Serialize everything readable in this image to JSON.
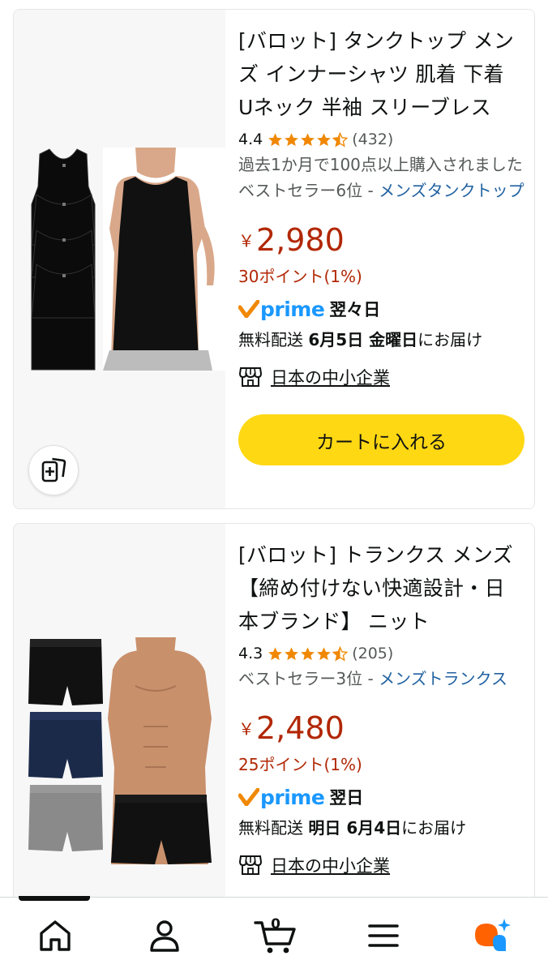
{
  "products": [
    {
      "title": "[バロット] タンクトップ メンズ インナーシャツ 肌着 下着 Uネック 半袖 スリーブレス",
      "rating": "4.4",
      "rating_value": 4.4,
      "review_count": "(432)",
      "bought": "過去1か月で100点以上購入されました",
      "bestseller_rank": "ベストセラー6位 - ",
      "bestseller_category": "メンズタンクトップ",
      "price_symbol": "￥",
      "price": "2,980",
      "points": "30ポイント(1%)",
      "prime_label": "prime",
      "prime_day": "翌々日",
      "delivery_prefix": "無料配送 ",
      "delivery_date": "6月5日 金曜日",
      "delivery_suffix": "にお届け",
      "business_label": "日本の中小企業",
      "cart_label": "カートに入れる"
    },
    {
      "title": "[バロット] トランクス メンズ 【締め付けない快適設計・日本ブランド】 ニット",
      "rating": "4.3",
      "rating_value": 4.3,
      "review_count": "(205)",
      "bestseller_rank": "ベストセラー3位 - ",
      "bestseller_category": "メンズトランクス",
      "price_symbol": "￥",
      "price": "2,480",
      "points": "25ポイント(1%)",
      "prime_label": "prime",
      "prime_day": "翌日",
      "delivery_prefix": "無料配送 ",
      "delivery_date": "明日 6月4日",
      "delivery_suffix": "にお届け",
      "business_label": "日本の中小企業"
    }
  ],
  "nav": {
    "items": [
      "home-icon",
      "account-icon",
      "cart-icon",
      "menu-icon",
      "rufus-ai-icon"
    ],
    "cart_count": "0"
  },
  "colors": {
    "price": "#b12704",
    "link": "#2162a1",
    "star": "#f08804",
    "prime": "#1a98ff",
    "cart_button": "#ffd814"
  }
}
